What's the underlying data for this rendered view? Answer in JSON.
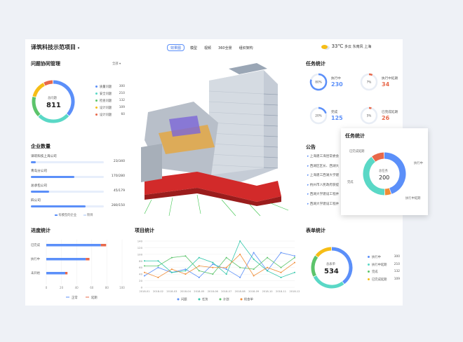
{
  "header": {
    "project_title": "译筑科技示范项目",
    "tabs": [
      {
        "label": "效果图",
        "active": true
      },
      {
        "label": "模型",
        "active": false
      },
      {
        "label": "视频",
        "active": false
      },
      {
        "label": "360全景",
        "active": false
      },
      {
        "label": "组织架构",
        "active": false
      }
    ],
    "weather": {
      "temp": "33℃",
      "desc": "多云",
      "wind": "东南风",
      "city": "上海"
    }
  },
  "issues": {
    "title": "问题协同管理",
    "filter": "全部",
    "center_label": "总问题",
    "total": "811",
    "legend": [
      {
        "name": "质量问题",
        "value": "300",
        "color": "#5b8ff9"
      },
      {
        "name": "安全问题",
        "value": "210",
        "color": "#5ad8c6"
      },
      {
        "name": "检查问题",
        "value": "132",
        "color": "#5cc46b"
      },
      {
        "name": "设计问题",
        "value": "109",
        "color": "#f6bd16"
      },
      {
        "name": "设计问题",
        "value": "60",
        "color": "#e8684a"
      }
    ]
  },
  "companies": {
    "title": "企业数量",
    "items": [
      {
        "name": "译筑科技上海公司",
        "value": "23/340",
        "frac": 0.07
      },
      {
        "name": "青岛分公司",
        "value": "170/280",
        "frac": 0.6
      },
      {
        "name": "总承包公司",
        "value": "45/179",
        "frac": 0.25
      },
      {
        "name": "四公司",
        "value": "280/150",
        "frac": 0.75
      }
    ],
    "legend": [
      "有模型的企业",
      "项目"
    ]
  },
  "progress": {
    "title": "进度统计",
    "chart_data": {
      "type": "bar",
      "categories": [
        "已完成",
        "执行中",
        "未开始"
      ],
      "series": [
        {
          "name": "正常",
          "values": [
            72,
            52,
            25
          ],
          "color": "#5b8ff9"
        },
        {
          "name": "延期",
          "values": [
            7,
            5,
            3
          ],
          "color": "#e8684a"
        }
      ],
      "xticks": [
        "0",
        "20",
        "40",
        "60",
        "80",
        "100"
      ],
      "xlim": [
        0,
        100
      ]
    }
  },
  "project_stats": {
    "title": "项目统计",
    "chart_data": {
      "type": "line",
      "x": [
        "2018-01",
        "2018-02",
        "2018-03",
        "2018-04",
        "2018-05",
        "2018-06",
        "2018-07",
        "2018-08",
        "2018-09",
        "2018-10",
        "2018-11",
        "2018-12"
      ],
      "yticks": [
        "0",
        "20",
        "40",
        "60",
        "80",
        "100",
        "120",
        "140"
      ],
      "ylim": [
        0,
        140
      ],
      "series": [
        {
          "name": "问题",
          "color": "#5b8ff9",
          "values": [
            35,
            60,
            45,
            55,
            30,
            70,
            55,
            30,
            105,
            50,
            105,
            95
          ]
        },
        {
          "name": "任务",
          "color": "#2fc6a9",
          "values": [
            80,
            80,
            45,
            50,
            90,
            75,
            40,
            140,
            85,
            50,
            30,
            45
          ]
        },
        {
          "name": "计划",
          "color": "#5cc46b",
          "values": [
            65,
            65,
            90,
            95,
            50,
            40,
            90,
            60,
            55,
            90,
            60,
            90
          ]
        },
        {
          "name": "检查单",
          "color": "#f08c35",
          "values": [
            45,
            30,
            55,
            40,
            65,
            60,
            60,
            100,
            35,
            60,
            45,
            75
          ]
        }
      ]
    }
  },
  "tasks": {
    "title": "任务统计",
    "items": [
      {
        "pct": "80%",
        "label": "执行中",
        "value": "230",
        "frac": 0.8,
        "color": "#5b8ff9"
      },
      {
        "pct": "7%",
        "label": "执行中延期",
        "value": "34",
        "frac": 0.07,
        "color": "#e8684a"
      },
      {
        "pct": "20%",
        "label": "完成",
        "value": "125",
        "frac": 0.2,
        "color": "#5b8ff9"
      },
      {
        "pct": "5%",
        "label": "已完成延期",
        "value": "26",
        "frac": 0.05,
        "color": "#e8684a"
      }
    ]
  },
  "notices": {
    "title": "公告",
    "items": [
      "上海建工海昆常委会",
      "西湖区区长、西湖大",
      "上海建工西湖大学建",
      "杭州市人民政府获提",
      "西湖大学建设工程并",
      "西湖大学建设工程并"
    ]
  },
  "form_stats": {
    "title": "表单统计",
    "center_label": "总表单",
    "total": "534",
    "legend": [
      {
        "name": "执行中",
        "value": "300",
        "color": "#5b8ff9"
      },
      {
        "name": "执行中延期",
        "value": "210",
        "color": "#5ad8c6"
      },
      {
        "name": "完成",
        "value": "132",
        "color": "#5cc46b"
      },
      {
        "name": "已完成延期",
        "value": "109",
        "color": "#f6bd16"
      }
    ]
  },
  "task_popup": {
    "title": "任务统计",
    "center_label": "总任务",
    "total": "200",
    "labels": [
      "已完成延期",
      "执行中",
      "完成",
      "执行中延期"
    ],
    "slices": [
      {
        "name": "执行中",
        "value": 45,
        "color": "#5b8ff9"
      },
      {
        "name": "执行中延期",
        "value": 5,
        "color": "#f08c35"
      },
      {
        "name": "完成",
        "value": 40,
        "color": "#5ad8c6"
      },
      {
        "name": "已完成延期",
        "value": 10,
        "color": "#e8684a"
      }
    ]
  }
}
